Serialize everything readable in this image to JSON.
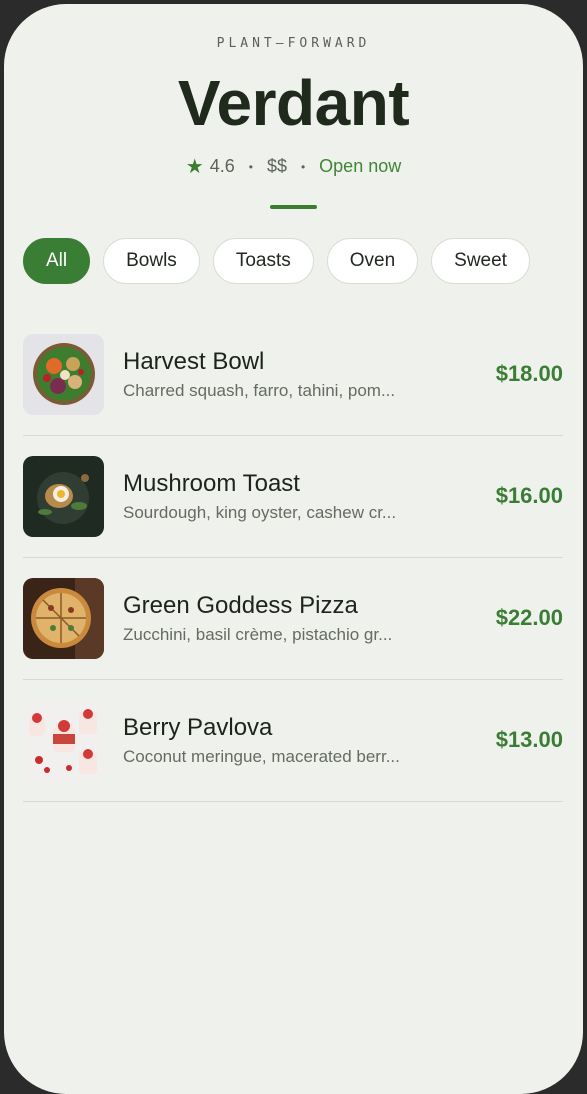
{
  "header": {
    "eyebrow": "PLANT—FORWARD",
    "title": "Verdant",
    "rating": "4.6",
    "price_level": "$$",
    "status": "Open now"
  },
  "filters": [
    {
      "label": "All",
      "active": true
    },
    {
      "label": "Bowls",
      "active": false
    },
    {
      "label": "Toasts",
      "active": false
    },
    {
      "label": "Oven",
      "active": false
    },
    {
      "label": "Sweet",
      "active": false
    }
  ],
  "menu": [
    {
      "name": "Harvest Bowl",
      "description": "Charred squash, farro, tahini, pom...",
      "price": "$18.00"
    },
    {
      "name": "Mushroom Toast",
      "description": "Sourdough, king oyster, cashew cr...",
      "price": "$16.00"
    },
    {
      "name": "Green Goddess Pizza",
      "description": "Zucchini, basil crème, pistachio gr...",
      "price": "$22.00"
    },
    {
      "name": "Berry Pavlova",
      "description": "Coconut meringue, macerated berr...",
      "price": "$13.00"
    }
  ],
  "colors": {
    "accent": "#3a7d34",
    "background": "#eff2ec",
    "frame": "#2b2b2b"
  },
  "icons": {
    "rating": "star-icon"
  }
}
